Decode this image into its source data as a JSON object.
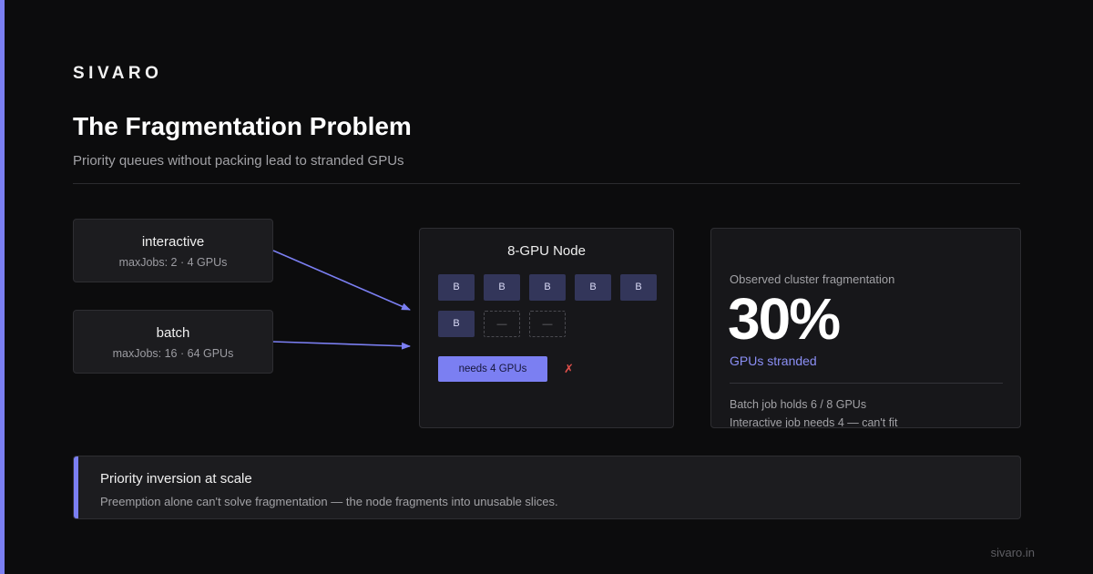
{
  "brand": "SIVARO",
  "title": "The Fragmentation Problem",
  "subtitle": "Priority queues without packing lead to stranded GPUs",
  "queues": [
    {
      "name": "interactive",
      "meta": "maxJobs: 2 · 4 GPUs"
    },
    {
      "name": "batch",
      "meta": "maxJobs: 16 · 64 GPUs"
    }
  ],
  "node": {
    "title": "8-GPU Node",
    "slots": [
      "B",
      "B",
      "B",
      "B",
      "B",
      "B",
      "—",
      "—"
    ],
    "job_label": "needs 4 GPUs",
    "fail_mark": "✗"
  },
  "stats": {
    "label": "Observed cluster fragmentation",
    "value": "30%",
    "unit": "GPUs stranded",
    "note1": "Batch job holds 6 / 8 GPUs",
    "note2": "Interactive job needs 4 — can't fit"
  },
  "callout": {
    "title": "Priority inversion at scale",
    "body": "Preemption alone can't solve fragmentation — the node fragments into unusable slices."
  },
  "footer": "sivaro.in",
  "colors": {
    "accent": "#7b7ff2",
    "gpu_used": "#33365a",
    "fail": "#e2504b",
    "background": "#0c0c0d"
  }
}
